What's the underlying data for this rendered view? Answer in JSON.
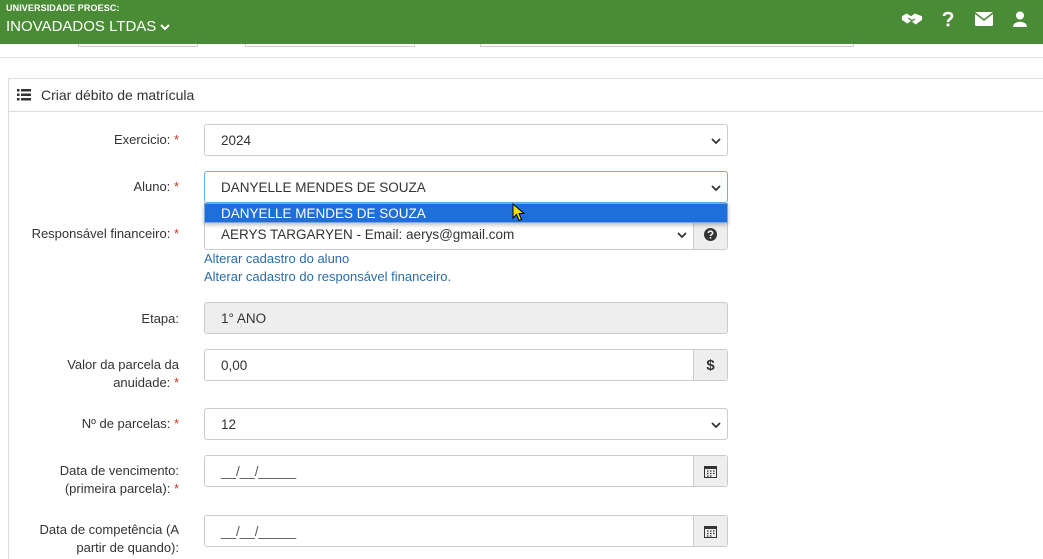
{
  "header": {
    "org": "UNIVERSIDADE PROESC:",
    "company": "INOVADADOS LTDAS",
    "icons": [
      "handshake-icon",
      "question-icon",
      "envelope-icon",
      "user-icon"
    ]
  },
  "panel": {
    "title": "Criar débito de matrícula"
  },
  "form": {
    "exercicio": {
      "label": "Exercicio:",
      "value": "2024"
    },
    "aluno": {
      "label": "Aluno:",
      "value": "DANYELLE MENDES DE SOUZA",
      "option": "DANYELLE MENDES DE SOUZA"
    },
    "responsavel": {
      "label": "Responsável financeiro:",
      "value": "AERYS TARGARYEN - Email: aerys@gmail.com"
    },
    "links": {
      "aluno": "Alterar cadastro do aluno",
      "responsavel": "Alterar cadastro do responsável financeiro."
    },
    "etapa": {
      "label": "Etapa:",
      "value": "1° ANO"
    },
    "valor": {
      "label_1": "Valor da parcela da",
      "label_2": "anuidade:",
      "value": "0,00",
      "addon": "$"
    },
    "parcelas": {
      "label": "Nº de parcelas:",
      "value": "12"
    },
    "vencimento": {
      "label_1": "Data de vencimento:",
      "label_2": "(primeira parcela):",
      "value": "__/__/_____"
    },
    "competencia": {
      "label_1": "Data de competência (A",
      "label_2": "partir de quando):",
      "value": "__/__/_____"
    },
    "required_mark": "*"
  },
  "colors": {
    "topbar": "#4a8c35",
    "highlight": "#1e6fd9",
    "link": "#2a6ca8",
    "required": "#c0392b"
  }
}
